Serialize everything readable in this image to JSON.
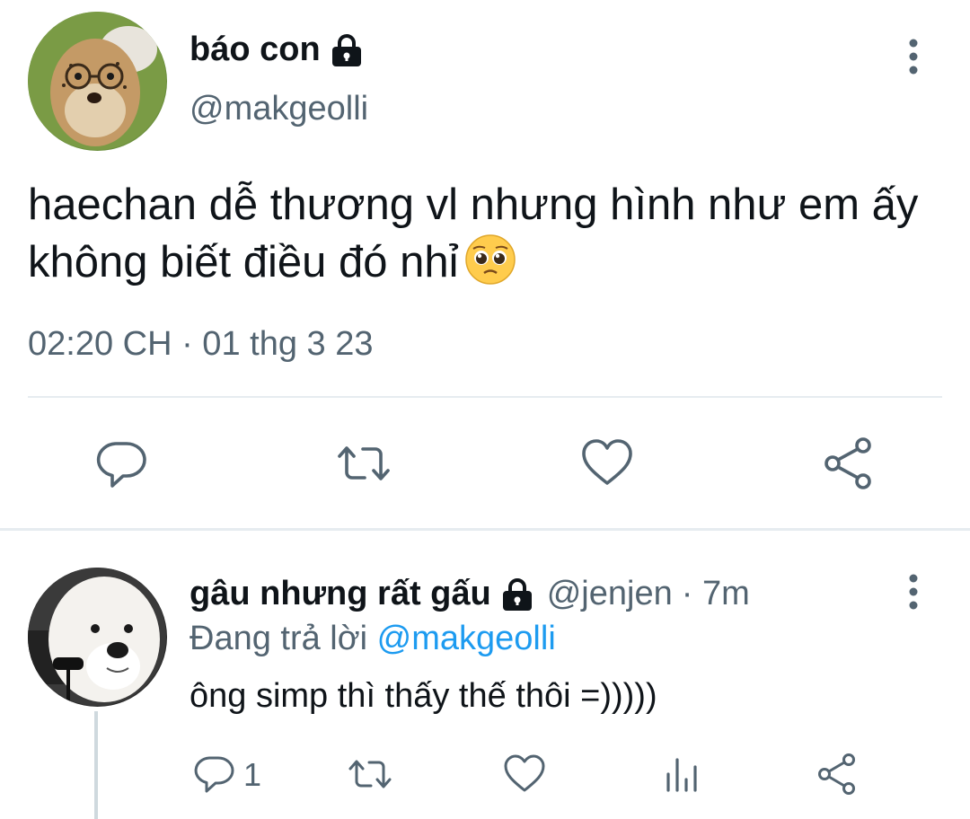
{
  "tweet": {
    "author": {
      "display_name": "báo con",
      "handle": "@makgeolli",
      "protected_icon": "lock-icon",
      "avatar": "cheetah-cub-with-glasses"
    },
    "text": "haechan dễ thương vl nhưng hình như em ấy không biết điều đó nhỉ",
    "emoji": "pleading-face-emoji",
    "timestamp": "02:20 CH · 01 thg 3 23",
    "actions": [
      "reply-icon",
      "retweet-icon",
      "like-icon",
      "share-icon"
    ],
    "more_icon": "more-vertical-icon"
  },
  "reply": {
    "author": {
      "display_name": "gâu nhưng rất gấu",
      "handle": "@jenjen",
      "time_ago": "· 7m",
      "protected_icon": "lock-icon",
      "avatar": "white-samoyed-dog"
    },
    "replying_prefix": "Đang trả lời",
    "replying_to": "@makgeolli",
    "text": "ông simp thì thấy thế thôi =)))))",
    "reply_count": "1",
    "actions": [
      "reply-icon",
      "retweet-icon",
      "like-icon",
      "analytics-icon",
      "share-icon"
    ],
    "more_icon": "more-vertical-icon"
  },
  "colors": {
    "primary_text": "#0f1419",
    "secondary_text": "#536471",
    "link": "#1d9bf0",
    "divider": "#e6ecf0"
  }
}
